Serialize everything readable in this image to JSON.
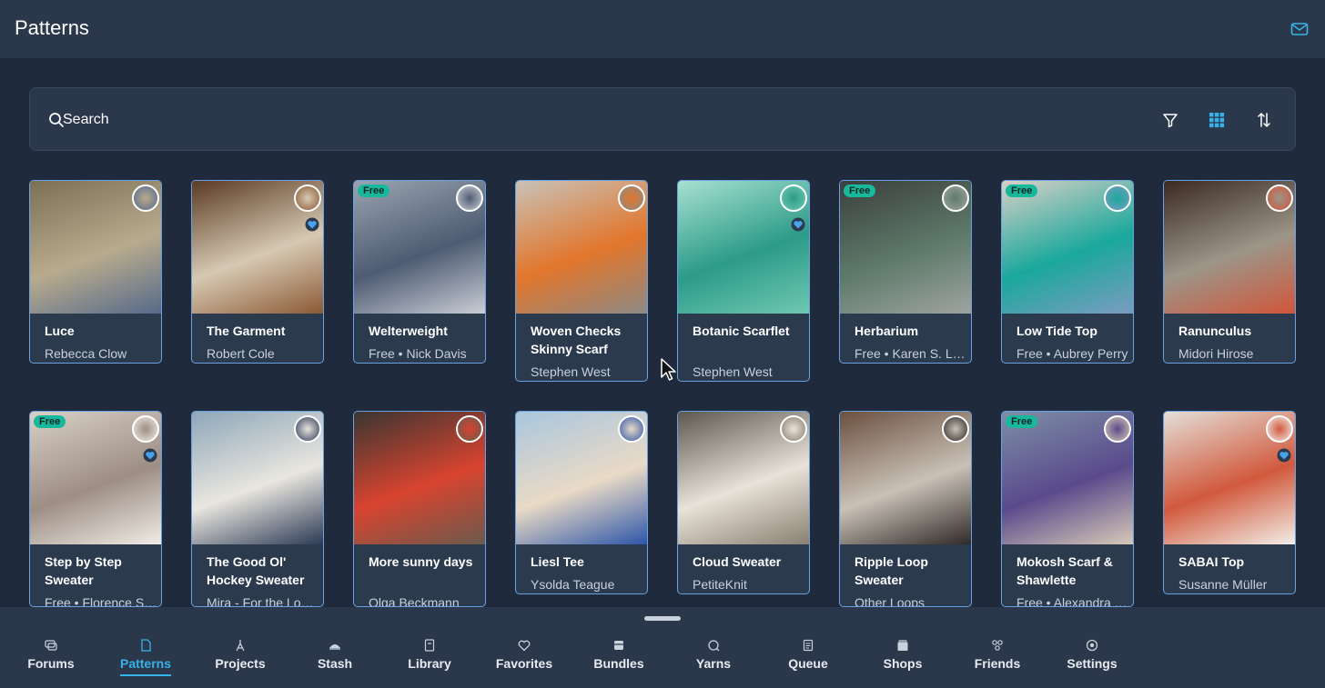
{
  "header": {
    "title": "Patterns",
    "mail_icon": "mail-icon"
  },
  "search": {
    "placeholder": "Search"
  },
  "toolbar": {
    "filter_icon": "filter-icon",
    "grid_icon": "grid-view-icon",
    "sort_icon": "sort-icon"
  },
  "colors": {
    "accent": "#35b3e8",
    "free_badge": "#18b89c",
    "card_border": "#6aa1e0",
    "background": "#1f2b3c"
  },
  "row1": [
    {
      "name": "Luce",
      "author": "Rebecca Clow",
      "free": "",
      "heart": false
    },
    {
      "name": "The Garment",
      "author": "Robert Cole",
      "free": "",
      "heart": true
    },
    {
      "name": "Welterweight",
      "author": "Free • Nick Davis",
      "free": "Free",
      "heart": false
    },
    {
      "name": "Woven Checks Skinny Scarf",
      "author": "Stephen West",
      "free": "",
      "heart": false
    },
    {
      "name": "Botanic Scarflet",
      "author": "Stephen West",
      "free": "",
      "heart": true
    },
    {
      "name": "Herbarium",
      "author": "Free • Karen S. Lauger",
      "free": "Free",
      "heart": false
    },
    {
      "name": "Low Tide Top",
      "author": "Free • Aubrey Perry",
      "free": "Free",
      "heart": false
    },
    {
      "name": "Ranunculus",
      "author": "Midori Hirose",
      "free": "",
      "heart": false
    }
  ],
  "row2": [
    {
      "name": "Step by Step Sweater",
      "author": "Free • Florence Spurling",
      "free": "Free",
      "heart": true
    },
    {
      "name": "The Good Ol' Hockey Sweater",
      "author": "Mira - For the Love of Yarn",
      "free": "",
      "heart": false
    },
    {
      "name": "More sunny days",
      "author": "Olga Beckmann",
      "free": "",
      "heart": false
    },
    {
      "name": "Liesl Tee",
      "author": "Ysolda Teague",
      "free": "",
      "heart": false
    },
    {
      "name": "Cloud Sweater",
      "author": "PetiteKnit",
      "free": "",
      "heart": false
    },
    {
      "name": "Ripple Loop Sweater",
      "author": "Other Loops",
      "free": "",
      "heart": false
    },
    {
      "name": "Mokosh Scarf & Shawlette",
      "author": "Free • Alexandra Tavel",
      "free": "Free",
      "heart": false
    },
    {
      "name": "SABAI Top",
      "author": "Susanne Müller",
      "free": "",
      "heart": true
    }
  ],
  "nav": [
    {
      "label": "Forums",
      "icon": "forums-icon"
    },
    {
      "label": "Patterns",
      "icon": "patterns-icon",
      "active": true
    },
    {
      "label": "Projects",
      "icon": "projects-icon"
    },
    {
      "label": "Stash",
      "icon": "stash-icon"
    },
    {
      "label": "Library",
      "icon": "library-icon"
    },
    {
      "label": "Favorites",
      "icon": "favorites-icon"
    },
    {
      "label": "Bundles",
      "icon": "bundles-icon"
    },
    {
      "label": "Yarns",
      "icon": "yarns-icon"
    },
    {
      "label": "Queue",
      "icon": "queue-icon"
    },
    {
      "label": "Shops",
      "icon": "shops-icon"
    },
    {
      "label": "Friends",
      "icon": "friends-icon"
    },
    {
      "label": "Settings",
      "icon": "settings-icon"
    }
  ]
}
